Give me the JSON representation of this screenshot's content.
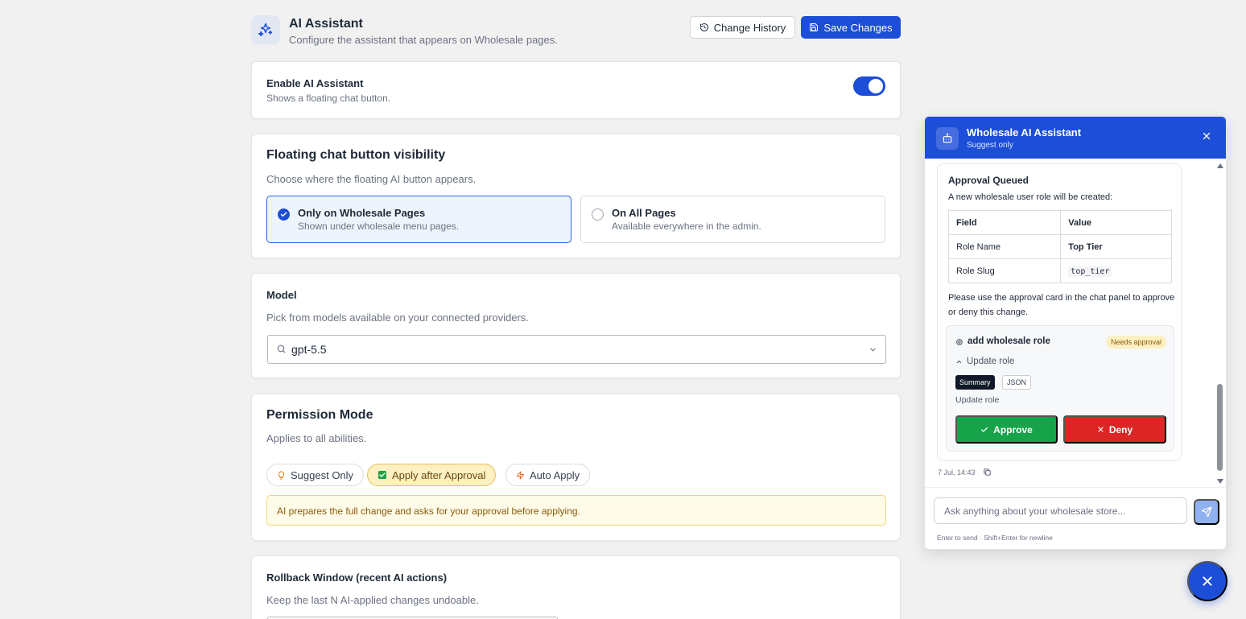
{
  "header": {
    "title": "AI Assistant",
    "subtitle": "Configure the assistant that appears on Wholesale pages.",
    "history_label": "Change History",
    "save_label": "Save Changes"
  },
  "enable": {
    "title": "Enable AI Assistant",
    "desc": "Shows a floating chat button.",
    "enabled": true
  },
  "visibility": {
    "title": "Floating chat button visibility",
    "desc": "Choose where the floating AI button appears.",
    "options": [
      {
        "title": "Only on Wholesale Pages",
        "sub": "Shown under wholesale menu pages.",
        "selected": true
      },
      {
        "title": "On All Pages",
        "sub": "Available everywhere in the admin.",
        "selected": false
      }
    ]
  },
  "model": {
    "title": "Model",
    "desc": "Pick from models available on your connected providers.",
    "value": "gpt-5.5"
  },
  "permission": {
    "title": "Permission Mode",
    "desc": "Applies to all abilities.",
    "modes": [
      {
        "label": "Suggest Only",
        "icon": "lightbulb-icon",
        "active": false
      },
      {
        "label": "Apply after Approval",
        "icon": "checkbox-icon",
        "active": true
      },
      {
        "label": "Auto Apply",
        "icon": "lightning-icon",
        "active": false
      }
    ],
    "notice": "AI prepares the full change and asks for your approval before applying."
  },
  "rollback": {
    "title": "Rollback Window (recent AI actions)",
    "desc": "Keep the last N AI-applied changes undoable."
  },
  "chat": {
    "title": "Wholesale AI Assistant",
    "subtitle": "Suggest only",
    "message": {
      "heading": "Approval Queued",
      "intro": "A new wholesale user role will be created:",
      "table": {
        "headers": [
          "Field",
          "Value"
        ],
        "rows": [
          {
            "field": "Role Name",
            "value": "Top Tier"
          },
          {
            "field": "Role Slug",
            "value": "top_tier"
          }
        ]
      },
      "note": "Please use the approval card in the chat panel to approve or deny this change.",
      "approval": {
        "title": "add wholesale role",
        "badge": "Needs approval",
        "expander": "Update role",
        "tabs": [
          "Summary",
          "JSON"
        ],
        "desc": "Update role",
        "approve_label": "Approve",
        "deny_label": "Deny"
      },
      "timestamp": "7 Jul, 14:43"
    },
    "input_placeholder": "Ask anything about your wholesale store...",
    "hint": "Enter to send · Shift+Enter for newline"
  },
  "colors": {
    "accent": "#1d4ed8",
    "approve": "#16a34a",
    "deny": "#dc2626",
    "notice_bg": "#fefbe8"
  }
}
